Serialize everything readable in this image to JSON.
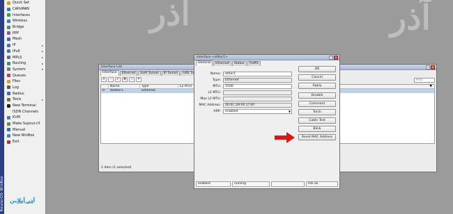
{
  "brand_vertical": "RouterOS WinBox",
  "menu": [
    {
      "label": "Quick Set",
      "color": "#c7a13a",
      "arrow": false
    },
    {
      "label": "CAPsMAN",
      "color": "#2f7fc9",
      "arrow": false
    },
    {
      "label": "Interfaces",
      "color": "#3a9a4a",
      "arrow": false
    },
    {
      "label": "Wireless",
      "color": "#3a7ec9",
      "arrow": false
    },
    {
      "label": "Bridge",
      "color": "#5a8a5a",
      "arrow": false
    },
    {
      "label": "PPP",
      "color": "#8a5aa0",
      "arrow": false
    },
    {
      "label": "Mesh",
      "color": "#4a6a9a",
      "arrow": false
    },
    {
      "label": "IP",
      "color": "#4a70b0",
      "arrow": true
    },
    {
      "label": "IPv6",
      "color": "#4a70b0",
      "arrow": true
    },
    {
      "label": "MPLS",
      "color": "#6a6a6a",
      "arrow": true
    },
    {
      "label": "Routing",
      "color": "#3a8a7a",
      "arrow": true
    },
    {
      "label": "System",
      "color": "#7a7a7a",
      "arrow": true
    },
    {
      "label": "Queues",
      "color": "#b04a4a",
      "arrow": false
    },
    {
      "label": "Files",
      "color": "#c9a03a",
      "arrow": false
    },
    {
      "label": "Log",
      "color": "#5a5a5a",
      "arrow": false
    },
    {
      "label": "Radius",
      "color": "#3a6ab0",
      "arrow": false
    },
    {
      "label": "Tools",
      "color": "#8a6a3a",
      "arrow": true
    },
    {
      "label": "New Terminal",
      "color": "#222222",
      "arrow": false
    },
    {
      "label": "ISDN Channels",
      "color": "#f0f0f0",
      "arrow": false
    },
    {
      "label": "KVM",
      "color": "#4a7ab0",
      "arrow": false
    },
    {
      "label": "Make Supout.rif",
      "color": "#6a8a4a",
      "arrow": false
    },
    {
      "label": "Manual",
      "color": "#3a6ab0",
      "arrow": false
    },
    {
      "label": "New WinBox",
      "color": "#3a8ac9",
      "arrow": false
    },
    {
      "label": "Exit",
      "color": "#b03a3a",
      "arrow": false
    }
  ],
  "logo": {
    "main": "آذر آنلاین",
    "sub": "AZAR ONLINE"
  },
  "watermark_text": "آذر",
  "iflist": {
    "title": "Interface List",
    "tabs": [
      "Interface",
      "Ethernet",
      "EoIP Tunnel",
      "IP Tunnel",
      "GRE Tunnel"
    ],
    "columns": [
      "",
      "Name",
      "Type",
      "L2 MTU"
    ],
    "rows": [
      {
        "flag": "R",
        "name": "ether1",
        "type": "Ethernet",
        "l2mtu": ""
      }
    ],
    "find_placeholder": "Find",
    "status": "1 item (1 selected)"
  },
  "dialog": {
    "title": "Interface <ether1>",
    "tabs": [
      "General",
      "Ethernet",
      "Status",
      "Traffic"
    ],
    "fields": [
      {
        "label": "Name:",
        "value": "ether1",
        "readonly": false,
        "dropdown": false
      },
      {
        "label": "Type:",
        "value": "Ethernet",
        "readonly": true,
        "dropdown": false
      },
      {
        "label": "MTU:",
        "value": "1500",
        "readonly": false,
        "dropdown": false
      },
      {
        "label": "L2 MTU:",
        "value": "",
        "readonly": true,
        "dropdown": false
      },
      {
        "label": "Max L2 MTU:",
        "value": "",
        "readonly": true,
        "dropdown": false
      },
      {
        "label": "MAC Address:",
        "value": "00:0C:29:F6:17:87",
        "readonly": true,
        "dropdown": false
      },
      {
        "label": "ARP:",
        "value": "enabled",
        "readonly": false,
        "dropdown": true
      }
    ],
    "buttons": [
      "OK",
      "Cancel",
      "Apply",
      "Disable",
      "Comment",
      "Torch",
      "Cable Test",
      "Blink",
      "Reset MAC Address"
    ],
    "status": [
      "enabled",
      "running",
      "",
      "link ok"
    ]
  },
  "colors": {
    "arrow": "#e01515",
    "background": "#9b9b9b"
  }
}
